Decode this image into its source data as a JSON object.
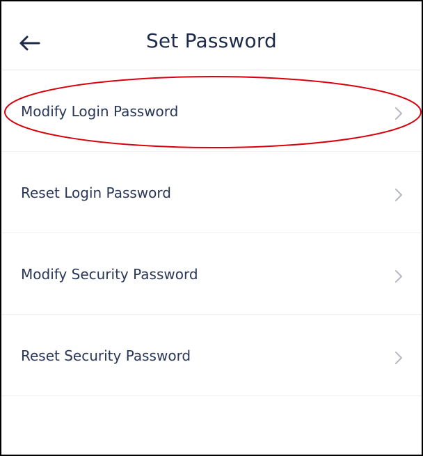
{
  "header": {
    "title": "Set Password",
    "back_icon": "arrow-left-icon"
  },
  "menu": {
    "items": [
      {
        "label": "Modify Login Password",
        "icon": "chevron-right-icon"
      },
      {
        "label": "Reset Login Password",
        "icon": "chevron-right-icon"
      },
      {
        "label": "Modify Security Password",
        "icon": "chevron-right-icon"
      },
      {
        "label": "Reset Security Password",
        "icon": "chevron-right-icon"
      }
    ]
  },
  "colors": {
    "text": "#2a3658",
    "title": "#1e2a4a",
    "chevron": "#b5b9c2",
    "highlight_ring": "#d8000c"
  }
}
